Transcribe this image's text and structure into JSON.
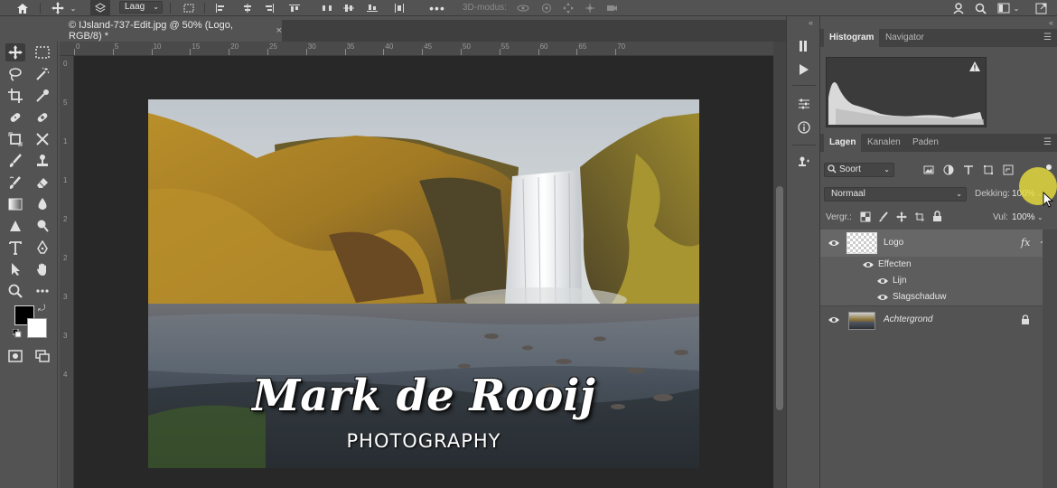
{
  "options_bar": {
    "layer_select": "Laag",
    "mode_3d": "3D-modus:"
  },
  "document": {
    "tab_title": "© IJsland-737-Edit.jpg @ 50% (Logo, RGB/8) *",
    "close": "×"
  },
  "ruler": {
    "top_numbers": [
      "0",
      "5",
      "10",
      "15",
      "20",
      "25",
      "30",
      "35",
      "40",
      "45",
      "50",
      "55",
      "60",
      "65",
      "70"
    ],
    "left_numbers": [
      "0",
      "5",
      "1",
      "1",
      "2",
      "2",
      "3",
      "3",
      "4"
    ]
  },
  "image": {
    "logo_script": "Mark de Rooij",
    "logo_sub": "PHOTOGRAPHY"
  },
  "histogram_panel": {
    "tabs": [
      "Histogram",
      "Navigator"
    ],
    "active_tab": "Histogram"
  },
  "layers_panel": {
    "tabs": [
      "Lagen",
      "Kanalen",
      "Paden"
    ],
    "active_tab": "Lagen",
    "filter": "Soort",
    "blend_mode": "Normaal",
    "opacity_label": "Dekking:",
    "opacity_value": "100%",
    "lock_label": "Vergr.:",
    "fill_label": "Vul:",
    "fill_value": "100%",
    "layers": [
      {
        "name": "Logo",
        "fx": "fx"
      },
      {
        "name": "Effecten"
      },
      {
        "name": "Lijn"
      },
      {
        "name": "Slagschaduw"
      },
      {
        "name": "Achtergrond"
      }
    ]
  },
  "colors": {
    "foreground": "#000000",
    "background": "#ffffff",
    "highlight": "#e6dc3c"
  },
  "icons": {
    "options_bar": [
      "home-icon",
      "move-icon",
      "layer-stack-icon",
      "align-icon",
      "more-icon",
      "3d-orbit-icon",
      "search-icon",
      "workspace-icon",
      "share-icon"
    ],
    "tools": [
      "move-tool-icon",
      "marquee-tool-icon",
      "lasso-tool-icon",
      "magic-wand-icon",
      "crop-tool-icon",
      "eyedropper-icon",
      "healing-brush-icon",
      "patch-icon",
      "frame-tool-icon",
      "brush-tool-icon",
      "clone-stamp-icon",
      "history-brush-icon",
      "eraser-icon",
      "gradient-icon",
      "blur-icon",
      "dodge-icon",
      "pen-icon",
      "type-tool-icon",
      "path-select-icon",
      "hand-tool-icon",
      "zoom-tool-icon",
      "more-tools-icon"
    ]
  }
}
